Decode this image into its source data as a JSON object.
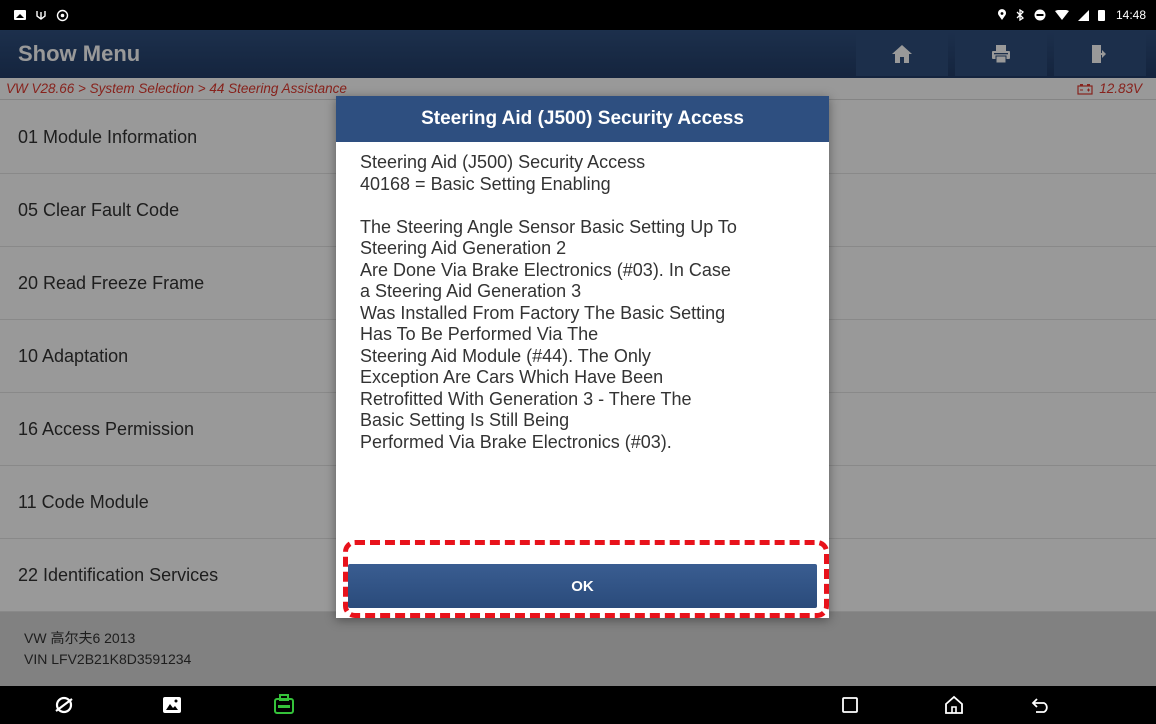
{
  "status_bar": {
    "time": "14:48"
  },
  "header": {
    "title": "Show Menu",
    "buttons": [
      "home-icon",
      "printer-icon",
      "exit-icon"
    ]
  },
  "breadcrumb": {
    "path": "VW V28.66 > System Selection > 44 Steering Assistance",
    "voltage": "12.83V"
  },
  "menu": {
    "items": [
      {
        "label": "01 Module Information"
      },
      {
        "label": "05 Clear Fault Code"
      },
      {
        "label": "20 Read Freeze Frame"
      },
      {
        "label": "10 Adaptation"
      },
      {
        "label": "16 Access Permission"
      },
      {
        "label": "11 Code Module"
      },
      {
        "label": "22 Identification Services"
      }
    ]
  },
  "vehicle": {
    "model": "VW 高尔夫6 2013",
    "vin": "VIN LFV2B21K8D3591234"
  },
  "dialog": {
    "title": "Steering Aid (J500) Security Access",
    "lines": [
      "Steering Aid (J500) Security Access",
      "40168 = Basic Setting Enabling",
      "",
      "The Steering Angle Sensor Basic Setting Up To",
      "Steering Aid Generation 2",
      "Are Done Via Brake Electronics (#03). In Case",
      "a Steering Aid Generation 3",
      "Was Installed From Factory The Basic Setting",
      "Has To Be Performed Via The",
      "Steering Aid Module (#44). The Only",
      "Exception Are Cars Which Have Been",
      "Retrofitted With Generation 3 - There The",
      "Basic Setting Is Still Being",
      "Performed Via Brake Electronics (#03)."
    ],
    "ok_label": "OK"
  },
  "colors": {
    "header": "#2e4f80",
    "breadcrumb": "#e23a30",
    "highlight": "#e8121b",
    "vci": "#35c23a"
  }
}
